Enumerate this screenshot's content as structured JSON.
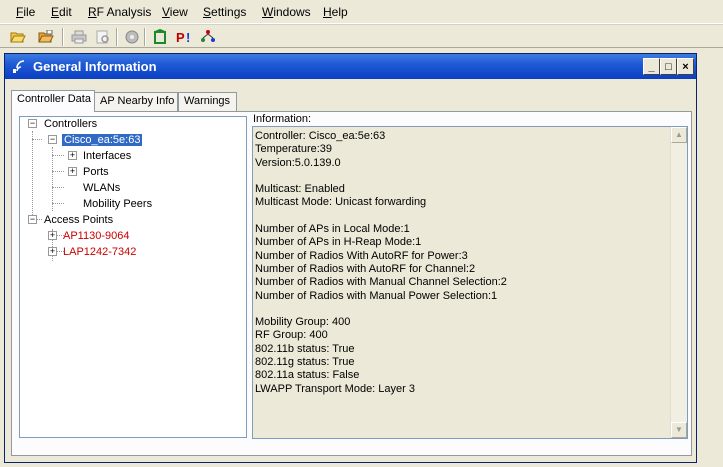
{
  "menubar": {
    "items": [
      {
        "mn": "F",
        "rest": "ile"
      },
      {
        "mn": "E",
        "rest": "dit"
      },
      {
        "mn": "R",
        "rest": "F Analysis"
      },
      {
        "mn": "V",
        "rest": "iew"
      },
      {
        "mn": "S",
        "rest": "ettings"
      },
      {
        "mn": "W",
        "rest": "indows"
      },
      {
        "mn": "H",
        "rest": "elp"
      }
    ]
  },
  "toolbar": {
    "icons": [
      "open-folder-icon",
      "open-file-icon",
      "print-icon",
      "print-preview-icon",
      "refresh-icon",
      "ap-icon",
      "p-alert-icon",
      "network-icon"
    ]
  },
  "window": {
    "title": "General Information",
    "min_glyph": "_",
    "max_glyph": "□",
    "close_glyph": "×"
  },
  "tabs": [
    {
      "label": "Controller Data",
      "active": true
    },
    {
      "label": "AP Nearby Info",
      "active": false
    },
    {
      "label": "Warnings",
      "active": false
    }
  ],
  "tree": {
    "controllers": "Controllers",
    "controller_name": "Cisco_ea:5e:63",
    "interfaces": "Interfaces",
    "ports": "Ports",
    "wlans": "WLANs",
    "mobility_peers": "Mobility Peers",
    "access_points": "Access Points",
    "ap1": "AP1130-9064",
    "ap2": "LAP1242-7342",
    "expanded_glyph": "−",
    "collapsed_glyph": "+"
  },
  "info": {
    "label": "Information:",
    "text": "Controller: Cisco_ea:5e:63\nTemperature:39\nVersion:5.0.139.0\n\nMulticast: Enabled\nMulticast Mode: Unicast forwarding\n\nNumber of APs in Local Mode:1\nNumber of APs in H-Reap Mode:1\nNumber of Radios With AutoRF for Power:3\nNumber of Radios with AutoRF for Channel:2\nNumber of Radios with Manual Channel Selection:2\nNumber of Radios with Manual Power Selection:1\n\nMobility Group: 400\nRF Group: 400\n802.11b status: True\n802.11g status: True\n802.11a status: False\nLWAPP Transport Mode: Layer 3",
    "scroll_up": "▲",
    "scroll_down": "▼"
  },
  "colors": {
    "title_bar": "#1f5ad6",
    "selection": "#316ac5",
    "ap_text": "#cc0000"
  }
}
